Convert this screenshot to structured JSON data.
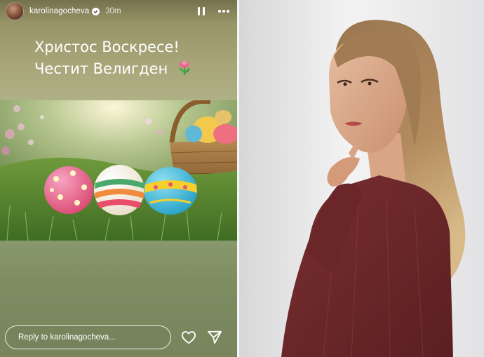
{
  "story": {
    "username": "karolinagocheva",
    "time_ago": "30m",
    "greeting_line1": "Христос Воскресе!",
    "greeting_line2": "Честит Велигден",
    "reply_placeholder": "Reply to karolinagocheva..."
  },
  "colors": {
    "story_bg_top": "#a8a679",
    "story_bg_bottom": "#77845c",
    "dress": "#6e2a2c"
  }
}
